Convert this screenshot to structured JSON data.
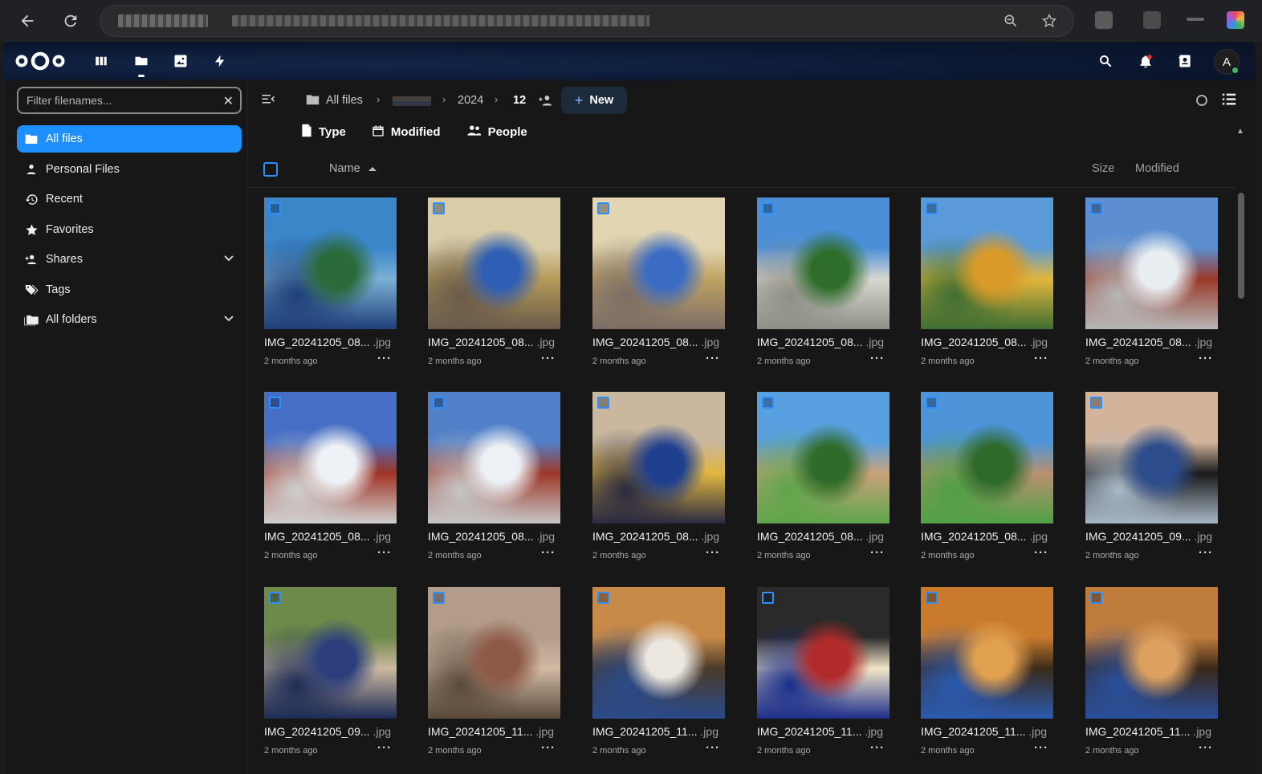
{
  "browser": {
    "back_icon": "arrow-left-icon",
    "reload_icon": "reload-icon",
    "zoom_icon": "zoom-icon",
    "star_icon": "star-icon"
  },
  "header": {
    "logo": "nextcloud-logo",
    "apps": [
      "dashboard",
      "files",
      "photos",
      "activity"
    ],
    "avatar_initial": "A",
    "status_color": "#46ba61"
  },
  "sidebar": {
    "filter_placeholder": "Filter filenames...",
    "items": [
      {
        "label": "All files",
        "icon": "folder-icon",
        "active": true
      },
      {
        "label": "Personal Files",
        "icon": "person-icon",
        "active": false
      },
      {
        "label": "Recent",
        "icon": "history-icon",
        "active": false
      },
      {
        "label": "Favorites",
        "icon": "star-icon",
        "active": false
      },
      {
        "label": "Shares",
        "icon": "share-icon",
        "active": false,
        "expandable": true
      },
      {
        "label": "Tags",
        "icon": "tag-icon",
        "active": false
      },
      {
        "label": "All folders",
        "icon": "folder-multiple-icon",
        "active": false,
        "expandable": true
      }
    ]
  },
  "breadcrumb": {
    "root": "All files",
    "year": "2024",
    "month": "12",
    "new_label": "New"
  },
  "filters": {
    "type": "Type",
    "modified": "Modified",
    "people": "People"
  },
  "columns": {
    "name": "Name",
    "size": "Size",
    "modified": "Modified"
  },
  "files": [
    {
      "name": "IMG_20241205_08...",
      "ext": ".jpg",
      "date": "2 months ago",
      "palette": [
        "#3b86c9",
        "#2b6a3a",
        "#7bb0d6",
        "#1f3f78"
      ]
    },
    {
      "name": "IMG_20241205_08...",
      "ext": ".jpg",
      "date": "2 months ago",
      "palette": [
        "#d9cda8",
        "#2f5fb5",
        "#b59a58",
        "#6a5b4b"
      ]
    },
    {
      "name": "IMG_20241205_08...",
      "ext": ".jpg",
      "date": "2 months ago",
      "palette": [
        "#e2d6b2",
        "#3a6cc4",
        "#c0a264",
        "#7c6e66"
      ]
    },
    {
      "name": "IMG_20241205_08...",
      "ext": ".jpg",
      "date": "2 months ago",
      "palette": [
        "#4a8fd8",
        "#2f6e2a",
        "#d8d8d2",
        "#8f8f86"
      ]
    },
    {
      "name": "IMG_20241205_08...",
      "ext": ".jpg",
      "date": "2 months ago",
      "palette": [
        "#5b9ad8",
        "#d99a28",
        "#e3b63c",
        "#3f6e32"
      ]
    },
    {
      "name": "IMG_20241205_08...",
      "ext": ".jpg",
      "date": "2 months ago",
      "palette": [
        "#5d8fd0",
        "#e9eef3",
        "#9a3a2a",
        "#b6b6b6"
      ]
    },
    {
      "name": "IMG_20241205_08...",
      "ext": ".jpg",
      "date": "2 months ago",
      "palette": [
        "#466ec4",
        "#eef2f6",
        "#a03424",
        "#cfcfcf"
      ]
    },
    {
      "name": "IMG_20241205_08...",
      "ext": ".jpg",
      "date": "2 months ago",
      "palette": [
        "#5280c8",
        "#edf1f5",
        "#9c3828",
        "#c6c6c6"
      ]
    },
    {
      "name": "IMG_20241205_08...",
      "ext": ".jpg",
      "date": "2 months ago",
      "palette": [
        "#c9b79e",
        "#1f3f8f",
        "#e0b640",
        "#2a2a40"
      ]
    },
    {
      "name": "IMG_20241205_08...",
      "ext": ".jpg",
      "date": "2 months ago",
      "palette": [
        "#58a0e0",
        "#2f6b2a",
        "#c9a27a",
        "#5ea54a"
      ]
    },
    {
      "name": "IMG_20241205_08...",
      "ext": ".jpg",
      "date": "2 months ago",
      "palette": [
        "#4d94d8",
        "#2e6a2a",
        "#b99070",
        "#4fa045"
      ]
    },
    {
      "name": "IMG_20241205_09...",
      "ext": ".jpg",
      "date": "2 months ago",
      "palette": [
        "#d2b49c",
        "#2c4c8c",
        "#1a1a1a",
        "#a8b7c6"
      ]
    },
    {
      "name": "IMG_20241205_09...",
      "ext": ".jpg",
      "date": "2 months ago",
      "palette": [
        "#6e8a4a",
        "#2c3f7c",
        "#ccb8a0",
        "#1d2b55"
      ]
    },
    {
      "name": "IMG_20241205_11...",
      "ext": ".jpg",
      "date": "2 months ago",
      "palette": [
        "#b39c8a",
        "#8e5a48",
        "#d1b9a3",
        "#5a4a3a"
      ]
    },
    {
      "name": "IMG_20241205_11...",
      "ext": ".jpg",
      "date": "2 months ago",
      "palette": [
        "#c88a48",
        "#ece8e0",
        "#4a3a2a",
        "#2a4a8a"
      ]
    },
    {
      "name": "IMG_20241205_11...",
      "ext": ".jpg",
      "date": "2 months ago",
      "palette": [
        "#2a2a2a",
        "#b32a2a",
        "#f2e6c8",
        "#1c2e8a"
      ]
    },
    {
      "name": "IMG_20241205_11...",
      "ext": ".jpg",
      "date": "2 months ago",
      "palette": [
        "#c97a2c",
        "#e0a050",
        "#3a2a1a",
        "#2c5ab0"
      ]
    },
    {
      "name": "IMG_20241205_11...",
      "ext": ".jpg",
      "date": "2 months ago",
      "palette": [
        "#c07c3c",
        "#dca060",
        "#3a2818",
        "#2a4f9c"
      ]
    }
  ]
}
